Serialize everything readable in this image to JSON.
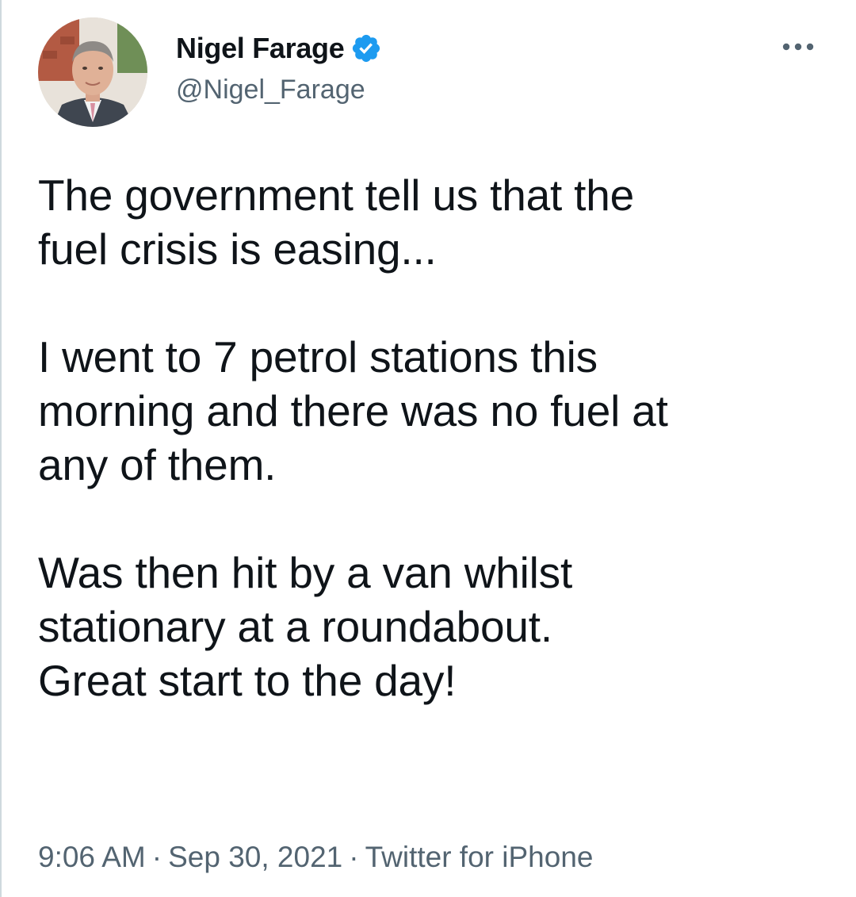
{
  "author": {
    "display_name": "Nigel Farage",
    "handle": "@Nigel_Farage",
    "verified": true
  },
  "tweet": {
    "paragraphs": [
      [
        "The government tell us that the",
        "fuel crisis is easing..."
      ],
      [
        "I went to 7 petrol stations this",
        "morning and there was no fuel at",
        "any of them."
      ],
      [
        "Was then hit by a van whilst",
        "stationary at a roundabout.",
        "Great start to the day!"
      ]
    ]
  },
  "meta": {
    "time": "9:06 AM",
    "separator": "·",
    "date": "Sep 30, 2021",
    "source": "Twitter for iPhone"
  },
  "icons": {
    "verified": "verified-badge-icon",
    "more": "more-options-icon"
  },
  "colors": {
    "verified_blue": "#1d9bf0",
    "text": "#0f1419",
    "secondary": "#536471"
  }
}
